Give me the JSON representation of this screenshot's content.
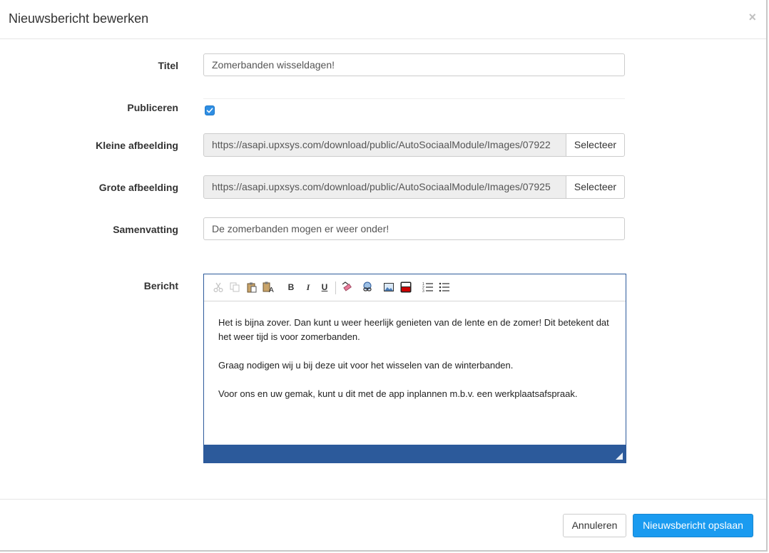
{
  "modal": {
    "title": "Nieuwsbericht bewerken",
    "close_symbol": "×"
  },
  "form": {
    "titel": {
      "label": "Titel",
      "value": "Zomerbanden wisseldagen!"
    },
    "publiceren": {
      "label": "Publiceren",
      "checked": true
    },
    "kleine_afbeelding": {
      "label": "Kleine afbeelding",
      "value": "https://asapi.upxsys.com/download/public/AutoSociaalModule/Images/07922",
      "button": "Selecteer"
    },
    "grote_afbeelding": {
      "label": "Grote afbeelding",
      "value": "https://asapi.upxsys.com/download/public/AutoSociaalModule/Images/07925",
      "button": "Selecteer"
    },
    "samenvatting": {
      "label": "Samenvatting",
      "value": "De zomerbanden mogen er weer onder!"
    },
    "bericht": {
      "label": "Bericht",
      "toolbar": {
        "bold": "B",
        "italic": "I",
        "underline": "U"
      },
      "paragraphs": [
        "Het is bijna zover. Dan kunt u weer heerlijk genieten van de lente en de zomer! Dit betekent dat het weer tijd is voor zomerbanden.",
        "Graag nodigen wij u bij deze uit voor het wisselen van de winterbanden.",
        "Voor ons en uw gemak, kunt u dit met de app inplannen m.b.v. een werkplaatsafspraak."
      ]
    }
  },
  "footer": {
    "cancel_label": "Annuleren",
    "save_label": "Nieuwsbericht opslaan"
  },
  "colors": {
    "primary": "#1a9bf0",
    "editor_border": "#2c5a9b",
    "checkbox": "#2f8ee3"
  }
}
